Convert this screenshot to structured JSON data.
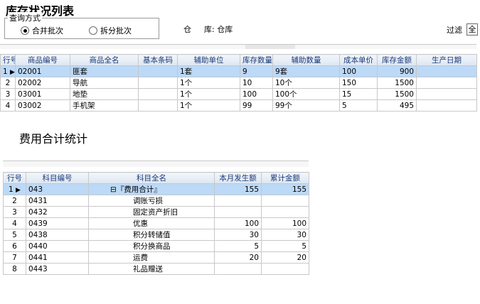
{
  "inventory": {
    "title": "库存状况列表",
    "query_mode": {
      "legend": "查询方式",
      "option1": "合并批次",
      "option2": "拆分批次"
    },
    "warehouse": {
      "label1": "仓",
      "label2": "库: 仓库"
    },
    "filter": {
      "label": "过滤",
      "value": "全"
    },
    "columns": [
      "行号",
      "商品编号",
      "商品全名",
      "基本条码",
      "辅助单位",
      "库存数量",
      "辅助数量",
      "成本单价",
      "库存金额",
      "生产日期"
    ],
    "rows": [
      {
        "no": "1",
        "code": "02001",
        "name": "匪套",
        "barcode": "",
        "unit": "1套",
        "qty": "9",
        "aux_qty": "9套",
        "cost": "100",
        "amount": "900",
        "date": ""
      },
      {
        "no": "2",
        "code": "02002",
        "name": "导航",
        "barcode": "",
        "unit": "1个",
        "qty": "10",
        "aux_qty": "10个",
        "cost": "150",
        "amount": "1500",
        "date": ""
      },
      {
        "no": "3",
        "code": "03001",
        "name": "地垫",
        "barcode": "",
        "unit": "1个",
        "qty": "100",
        "aux_qty": "100个",
        "cost": "15",
        "amount": "1500",
        "date": ""
      },
      {
        "no": "4",
        "code": "03002",
        "name": "手机架",
        "barcode": "",
        "unit": "1个",
        "qty": "99",
        "aux_qty": "99个",
        "cost": "5",
        "amount": "495",
        "date": ""
      }
    ]
  },
  "expense": {
    "title": "费用合计统计",
    "columns": [
      "行号",
      "科目编号",
      "科目全名",
      "本月发生额",
      "累计金额"
    ],
    "rows": [
      {
        "no": "1",
        "code": "043",
        "name": "⊟『费用合计』",
        "month": "155",
        "total": "155"
      },
      {
        "no": "2",
        "code": "0431",
        "name": "调账亏损",
        "month": "",
        "total": ""
      },
      {
        "no": "3",
        "code": "0432",
        "name": "固定资产折旧",
        "month": "",
        "total": ""
      },
      {
        "no": "4",
        "code": "0439",
        "name": "优惠",
        "month": "100",
        "total": "100"
      },
      {
        "no": "5",
        "code": "0438",
        "name": "积分转储值",
        "month": "30",
        "total": "30"
      },
      {
        "no": "6",
        "code": "0440",
        "name": "积分换商品",
        "month": "5",
        "total": "5"
      },
      {
        "no": "7",
        "code": "0441",
        "name": "运费",
        "month": "20",
        "total": "20"
      },
      {
        "no": "8",
        "code": "0443",
        "name": "礼品赠送",
        "month": "",
        "total": ""
      }
    ]
  }
}
